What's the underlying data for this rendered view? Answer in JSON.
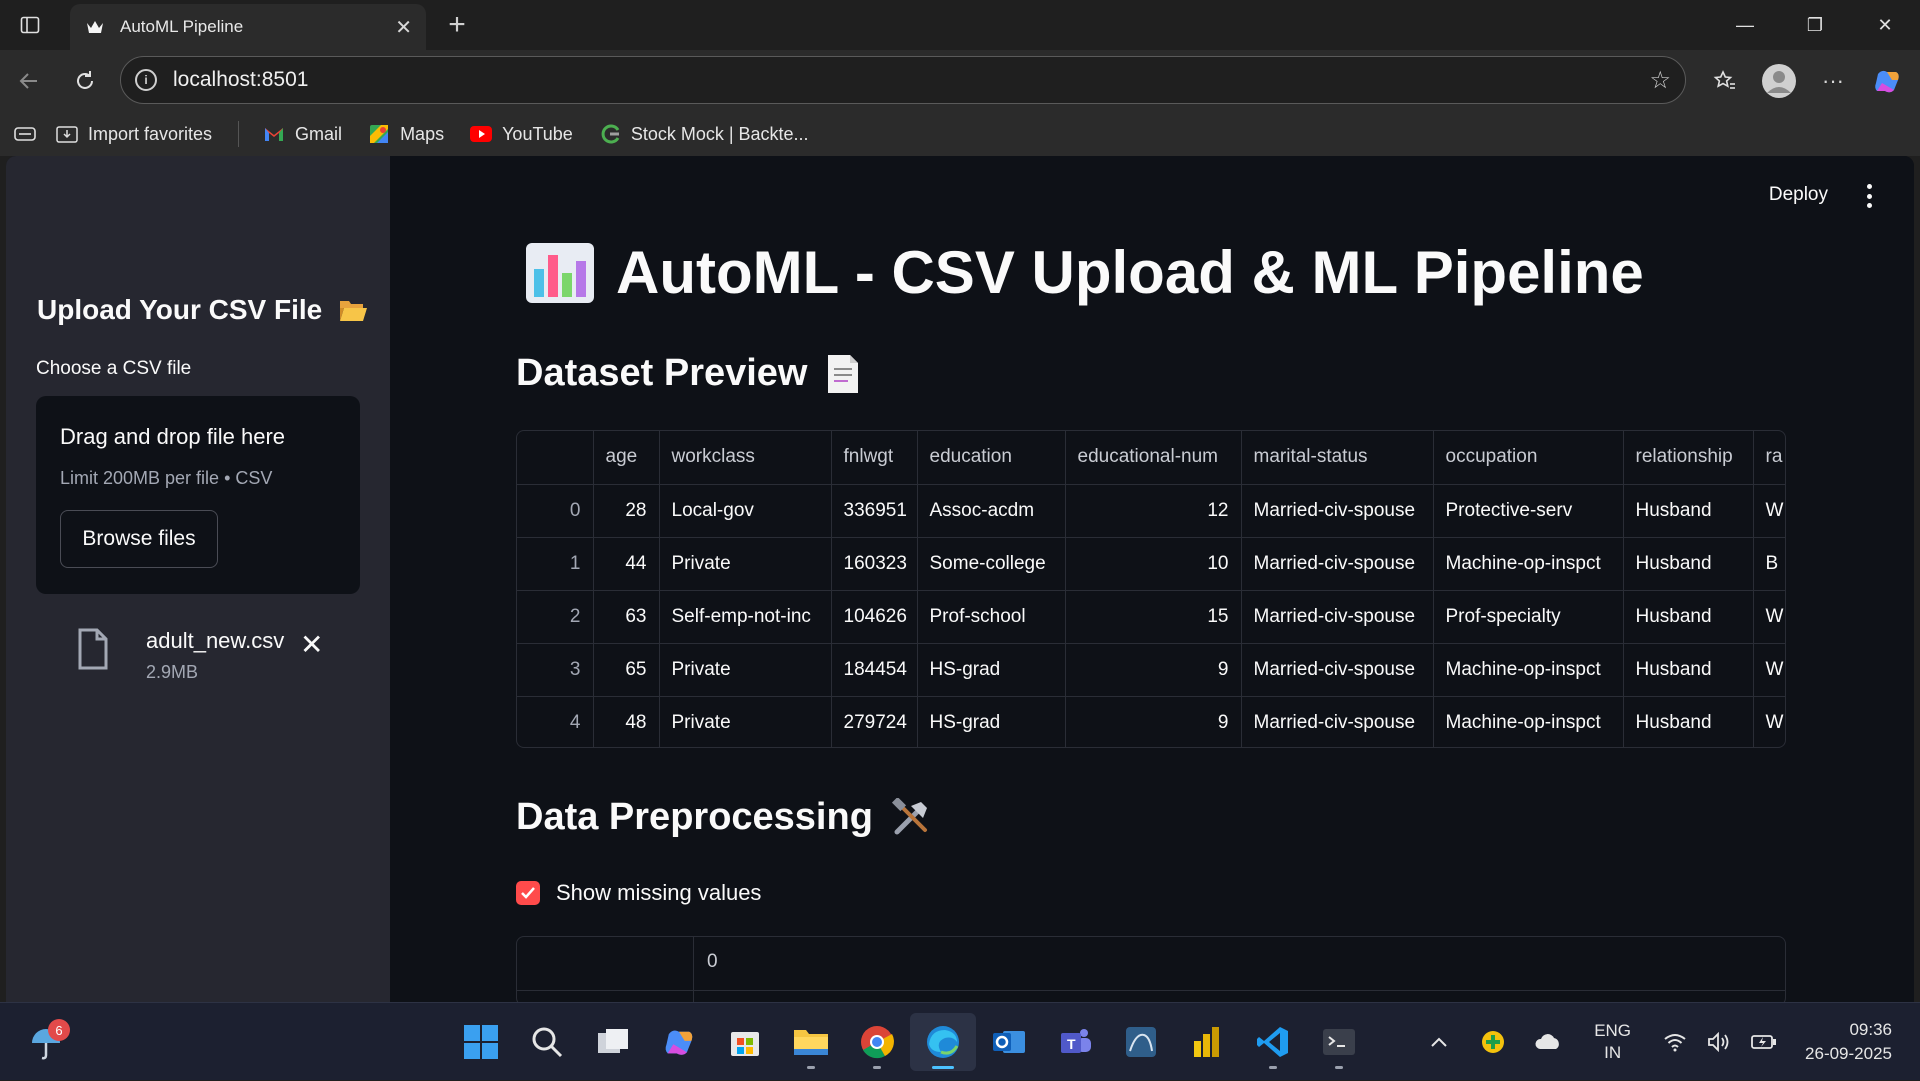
{
  "browser": {
    "tab_title": "AutoML Pipeline",
    "url": "localhost:8501",
    "bookmarks": [
      "Import favorites",
      "Gmail",
      "Maps",
      "YouTube",
      "Stock Mock | Backte..."
    ]
  },
  "sidebar": {
    "title": "Upload Your CSV File",
    "uploader_label": "Choose a CSV file",
    "dropzone_title": "Drag and drop file here",
    "dropzone_limit": "Limit 200MB per file • CSV",
    "browse_label": "Browse files",
    "file_name": "adult_new.csv",
    "file_size": "2.9MB"
  },
  "header": {
    "deploy_label": "Deploy"
  },
  "main": {
    "title": "AutoML - CSV Upload & ML Pipeline",
    "preview_heading": "Dataset Preview",
    "preprocessing_heading": "Data Preprocessing",
    "missing_checkbox_label": "Show missing values",
    "missing_checkbox_checked": true,
    "missing_table_header": "0"
  },
  "preview_table": {
    "columns": [
      "",
      "age",
      "workclass",
      "fnlwgt",
      "education",
      "educational-num",
      "marital-status",
      "occupation",
      "relationship",
      "ra"
    ],
    "rows": [
      [
        "0",
        "28",
        "Local-gov",
        "336951",
        "Assoc-acdm",
        "12",
        "Married-civ-spouse",
        "Protective-serv",
        "Husband",
        "W"
      ],
      [
        "1",
        "44",
        "Private",
        "160323",
        "Some-college",
        "10",
        "Married-civ-spouse",
        "Machine-op-inspct",
        "Husband",
        "B"
      ],
      [
        "2",
        "63",
        "Self-emp-not-inc",
        "104626",
        "Prof-school",
        "15",
        "Married-civ-spouse",
        "Prof-specialty",
        "Husband",
        "W"
      ],
      [
        "3",
        "65",
        "Private",
        "184454",
        "HS-grad",
        "9",
        "Married-civ-spouse",
        "Machine-op-inspct",
        "Husband",
        "W"
      ],
      [
        "4",
        "48",
        "Private",
        "279724",
        "HS-grad",
        "9",
        "Married-civ-spouse",
        "Machine-op-inspct",
        "Husband",
        "W"
      ]
    ]
  },
  "taskbar": {
    "weather_badge": "6",
    "lang_line1": "ENG",
    "lang_line2": "IN",
    "time": "09:36",
    "date": "26-09-2025"
  },
  "colors": {
    "accent": "#ff4b4b",
    "app_bg": "#0e1117",
    "sidebar_bg": "#262730"
  }
}
